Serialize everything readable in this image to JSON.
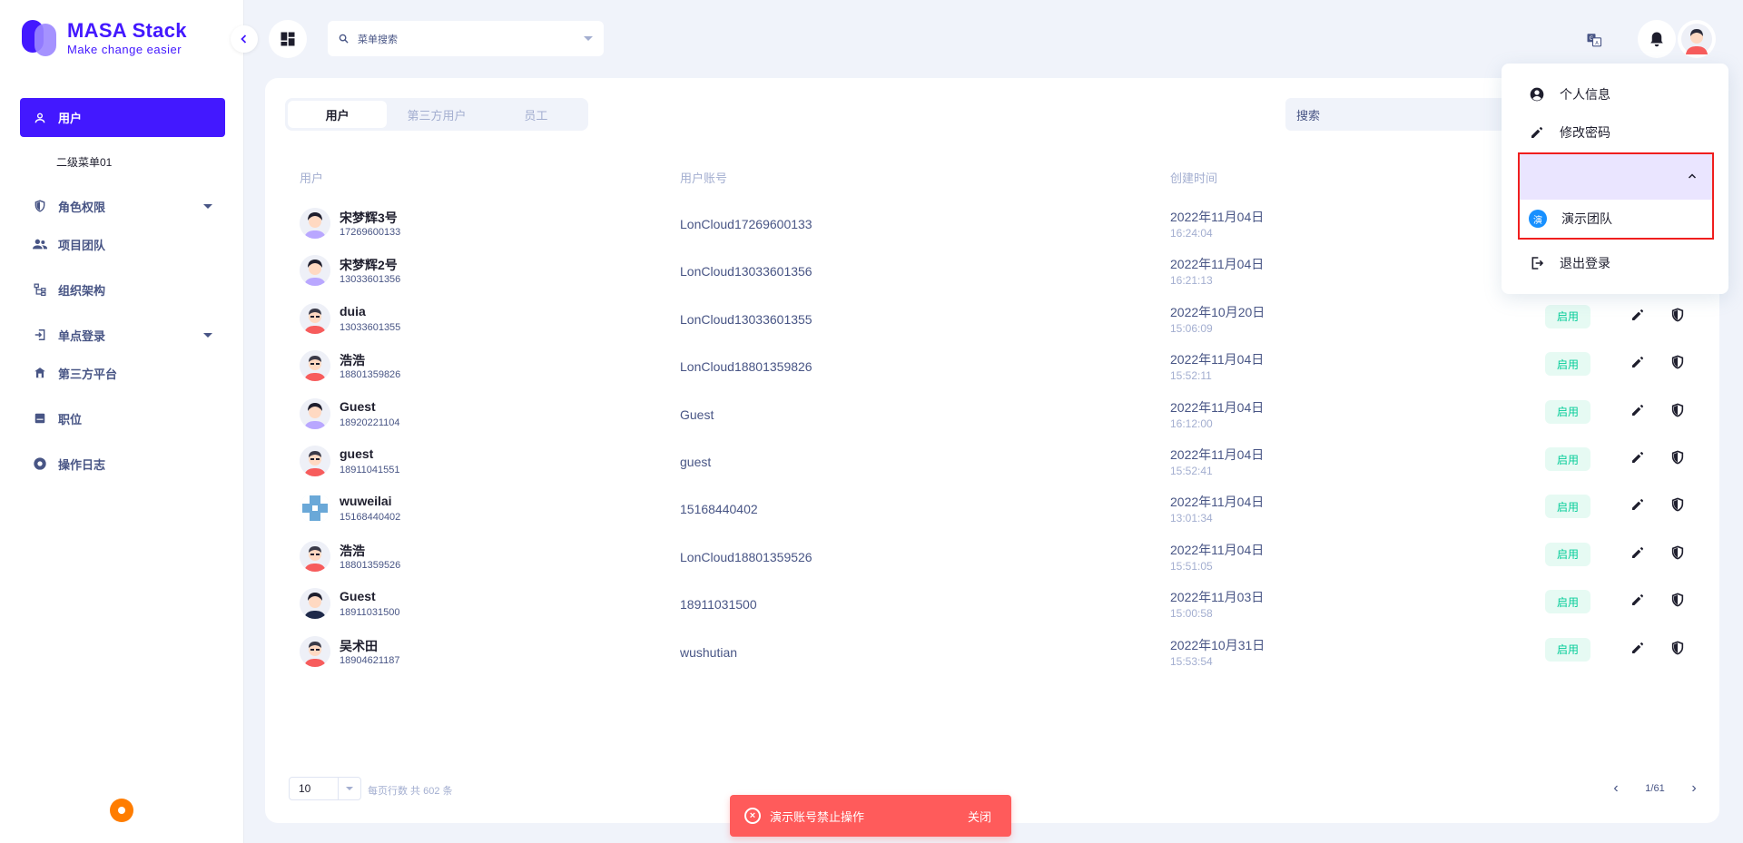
{
  "logo": {
    "title": "MASA Stack",
    "slogan": "Make change easier"
  },
  "sidebar": {
    "items": [
      {
        "label": "用户",
        "icon": "user-icon",
        "active": true
      },
      {
        "label": "二级菜单01",
        "icon": "",
        "sub": true
      },
      {
        "label": "角色权限",
        "icon": "shield-icon",
        "caret": true
      },
      {
        "label": "项目团队",
        "icon": "team-icon"
      },
      {
        "label": "组织架构",
        "icon": "org-icon"
      },
      {
        "label": "单点登录",
        "icon": "login-icon",
        "caret": true
      },
      {
        "label": "第三方平台",
        "icon": "platform-icon"
      },
      {
        "label": "职位",
        "icon": "position-icon"
      },
      {
        "label": "操作日志",
        "icon": "log-icon"
      }
    ]
  },
  "header": {
    "menu_search_placeholder": "菜单搜索"
  },
  "tabs": [
    "用户",
    "第三方用户",
    "员工"
  ],
  "search": {
    "placeholder": "搜索"
  },
  "table": {
    "columns": {
      "user": "用户",
      "account": "用户账号",
      "created": "创建时间"
    },
    "rows": [
      {
        "name": "宋梦辉3号",
        "phone": "17269600133",
        "account": "LonCloud17269600133",
        "date": "2022年11月04日",
        "time": "16:24:04",
        "status": "",
        "avatar": "purple"
      },
      {
        "name": "宋梦辉2号",
        "phone": "13033601356",
        "account": "LonCloud13033601356",
        "date": "2022年11月04日",
        "time": "16:21:13",
        "status": "",
        "avatar": "purple"
      },
      {
        "name": "duia",
        "phone": "13033601355",
        "account": "LonCloud13033601355",
        "date": "2022年10月20日",
        "time": "15:06:09",
        "status": "启用",
        "avatar": "red"
      },
      {
        "name": "浩浩",
        "phone": "18801359826",
        "account": "LonCloud18801359826",
        "date": "2022年11月04日",
        "time": "15:52:11",
        "status": "启用",
        "avatar": "red"
      },
      {
        "name": "Guest",
        "phone": "18920221104",
        "account": "Guest",
        "date": "2022年11月04日",
        "time": "16:12:00",
        "status": "启用",
        "avatar": "purple"
      },
      {
        "name": "guest",
        "phone": "18911041551",
        "account": "guest",
        "date": "2022年11月04日",
        "time": "15:52:41",
        "status": "启用",
        "avatar": "red"
      },
      {
        "name": "wuweilai",
        "phone": "15168440402",
        "account": "15168440402",
        "date": "2022年11月04日",
        "time": "13:01:34",
        "status": "启用",
        "avatar": "pixel"
      },
      {
        "name": "浩浩",
        "phone": "18801359526",
        "account": "LonCloud18801359526",
        "date": "2022年11月04日",
        "time": "15:51:05",
        "status": "启用",
        "avatar": "red"
      },
      {
        "name": "Guest",
        "phone": "18911031500",
        "account": "18911031500",
        "date": "2022年11月03日",
        "time": "15:00:58",
        "status": "启用",
        "avatar": "dark"
      },
      {
        "name": "吴术田",
        "phone": "18904621187",
        "account": "wushutian",
        "date": "2022年10月31日",
        "time": "15:53:54",
        "status": "启用",
        "avatar": "red"
      }
    ]
  },
  "pager": {
    "size": "10",
    "info": "每页行数 共 602 条",
    "page": "1/61"
  },
  "toast": {
    "message": "演示账号禁止操作",
    "close": "关闭"
  },
  "user_menu": {
    "profile": "个人信息",
    "change_password": "修改密码",
    "team_badge": "演",
    "team": "演示团队",
    "logout": "退出登录"
  },
  "colors": {
    "primary": "#4318ff",
    "success": "#05cd99",
    "danger": "#ff5b5b",
    "highlight_border": "#f01e1e"
  }
}
